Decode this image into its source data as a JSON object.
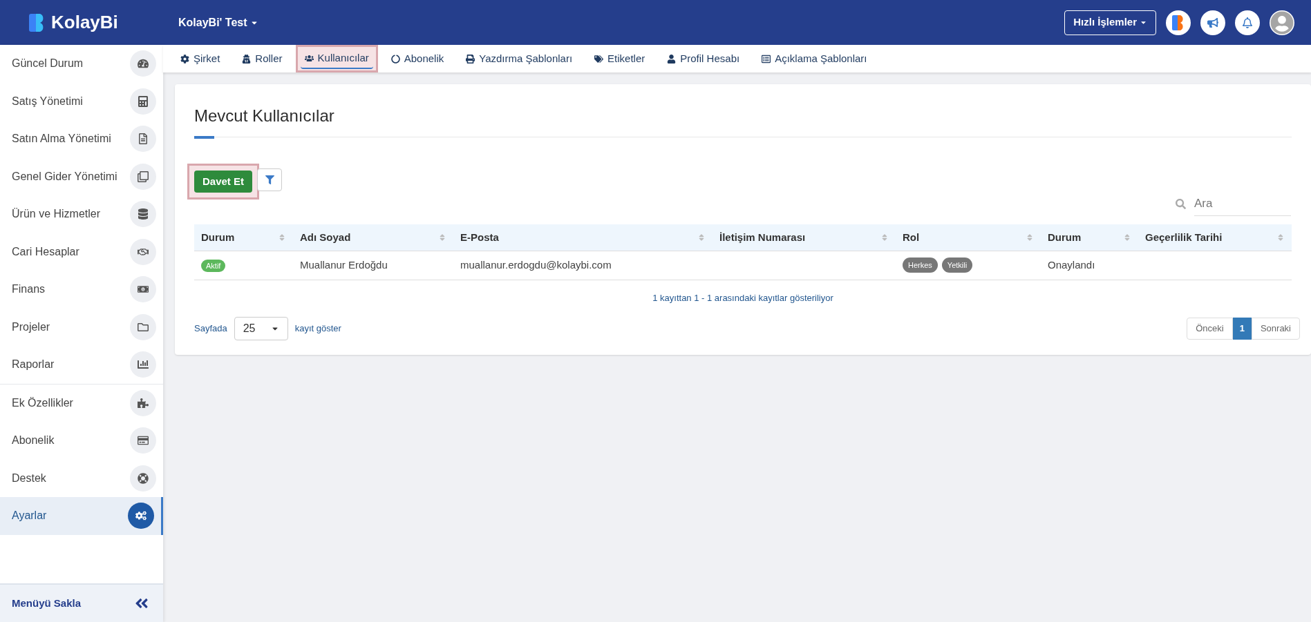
{
  "header": {
    "brand": "KolayBi",
    "company": "KolayBi' Test",
    "quick_actions": "Hızlı İşlemler"
  },
  "tabs": [
    {
      "label": "Şirket",
      "selected": false,
      "highlighted": false
    },
    {
      "label": "Roller",
      "selected": false,
      "highlighted": false
    },
    {
      "label": "Kullanıcılar",
      "selected": true,
      "highlighted": true
    },
    {
      "label": "Abonelik",
      "selected": false,
      "highlighted": false
    },
    {
      "label": "Yazdırma Şablonları",
      "selected": false,
      "highlighted": false
    },
    {
      "label": "Etiketler",
      "selected": false,
      "highlighted": false
    },
    {
      "label": "Profil Hesabı",
      "selected": false,
      "highlighted": false
    },
    {
      "label": "Açıklama Şablonları",
      "selected": false,
      "highlighted": false
    }
  ],
  "sidebar": {
    "groups": [
      [
        {
          "label": "Güncel Durum",
          "selected": false
        },
        {
          "label": "Satış Yönetimi",
          "selected": false
        },
        {
          "label": "Satın Alma Yönetimi",
          "selected": false
        },
        {
          "label": "Genel Gider Yönetimi",
          "selected": false
        },
        {
          "label": "Ürün ve Hizmetler",
          "selected": false
        },
        {
          "label": "Cari Hesaplar",
          "selected": false
        },
        {
          "label": "Finans",
          "selected": false
        },
        {
          "label": "Projeler",
          "selected": false
        },
        {
          "label": "Raporlar",
          "selected": false
        }
      ],
      [
        {
          "label": "Ek Özellikler",
          "selected": false
        },
        {
          "label": "Abonelik",
          "selected": false
        },
        {
          "label": "Destek",
          "selected": false
        },
        {
          "label": "Ayarlar",
          "selected": true
        }
      ]
    ],
    "hide_menu": "Menüyü Sakla"
  },
  "card": {
    "title": "Mevcut Kullanıcılar",
    "invite_button": {
      "label": "Davet Et",
      "highlighted": true
    },
    "search": {
      "placeholder": "Ara"
    },
    "table": {
      "columns": [
        "Durum",
        "Adı Soyad",
        "E-Posta",
        "İletişim Numarası",
        "Rol",
        "Durum",
        "Geçerlilik Tarihi"
      ],
      "rows": [
        {
          "status": "Aktif",
          "name": "Muallanur Erdoğdu",
          "email": "muallanur.erdogdu@kolaybi.com",
          "roles": [
            "Herkes",
            "Yetkili"
          ],
          "approval": "Onaylandı"
        }
      ]
    },
    "info": "1 kayıttan 1 - 1 arasındaki kayıtlar gösteriliyor",
    "page_size": {
      "before": "Sayfada",
      "value": "25",
      "after": "kayıt göster"
    },
    "pagination": {
      "previous": "Önceki",
      "pages": [
        {
          "label": "1",
          "selected": true
        }
      ],
      "next": "Sonraki"
    }
  }
}
